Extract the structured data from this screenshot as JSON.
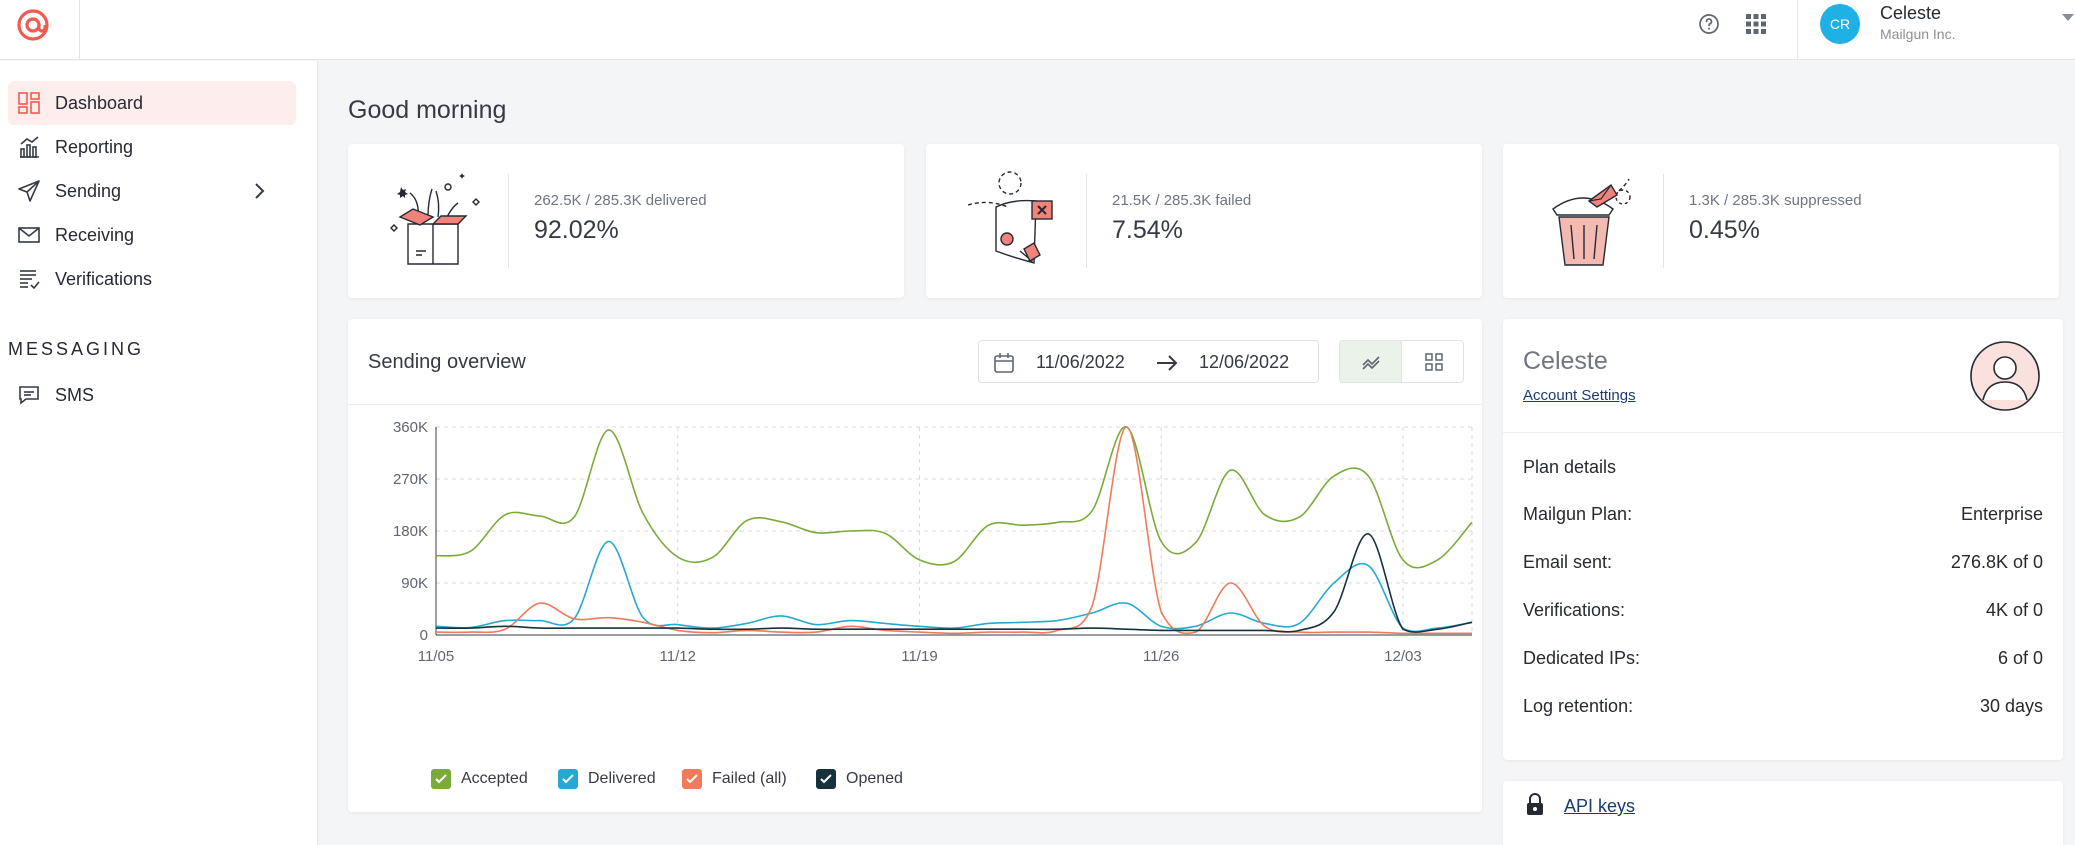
{
  "header": {
    "user_initials": "CR",
    "user_name": "Celeste",
    "user_org": "Mailgun Inc."
  },
  "sidebar": {
    "items": [
      {
        "label": "Dashboard",
        "icon": "dashboard-icon",
        "active": true
      },
      {
        "label": "Reporting",
        "icon": "bar-chart-icon"
      },
      {
        "label": "Sending",
        "icon": "paper-plane-icon",
        "expandable": true
      },
      {
        "label": "Receiving",
        "icon": "envelope-icon"
      },
      {
        "label": "Verifications",
        "icon": "checklist-icon"
      }
    ],
    "section_label": "MESSAGING",
    "messaging_items": [
      {
        "label": "SMS",
        "icon": "chat-icon"
      }
    ]
  },
  "greeting": "Good morning",
  "stats": [
    {
      "subtitle": "262.5K / 285.3K delivered",
      "value": "92.02%",
      "illustration": "open-box-illustration"
    },
    {
      "subtitle": "21.5K / 285.3K failed",
      "value": "7.54%",
      "illustration": "failed-letter-illustration"
    },
    {
      "subtitle": "1.3K / 285.3K suppressed",
      "value": "0.45%",
      "illustration": "trash-can-illustration"
    }
  ],
  "overview": {
    "title": "Sending overview",
    "date_start": "11/06/2022",
    "date_end": "12/06/2022",
    "view_selected": "line"
  },
  "profile": {
    "name": "Celeste",
    "account_settings": "Account Settings",
    "plan_title": "Plan details",
    "rows": [
      {
        "label": "Mailgun Plan:",
        "value": "Enterprise"
      },
      {
        "label": "Email sent:",
        "value": "276.8K of 0"
      },
      {
        "label": "Verifications:",
        "value": "4K of 0"
      },
      {
        "label": "Dedicated IPs:",
        "value": "6 of 0"
      },
      {
        "label": "Log retention:",
        "value": "30 days"
      }
    ]
  },
  "api": {
    "label": "API keys"
  },
  "colors": {
    "accent": "#f05a50",
    "accepted": "#7aab3a",
    "delivered": "#27a9cf",
    "failed": "#ef7b5c",
    "opened": "#16323d"
  },
  "chart_data": {
    "type": "line",
    "x_ticks": [
      "11/05",
      "11/12",
      "11/19",
      "11/26",
      "12/03"
    ],
    "x": [
      "11/05",
      "11/06",
      "11/07",
      "11/08",
      "11/09",
      "11/10",
      "11/11",
      "11/12",
      "11/13",
      "11/14",
      "11/15",
      "11/16",
      "11/17",
      "11/18",
      "11/19",
      "11/20",
      "11/21",
      "11/22",
      "11/23",
      "11/24",
      "11/25",
      "11/26",
      "11/27",
      "11/28",
      "11/29",
      "11/30",
      "12/01",
      "12/02",
      "12/03",
      "12/04",
      "12/05"
    ],
    "ylim": [
      0,
      360000
    ],
    "y_ticks": [
      "0",
      "90K",
      "180K",
      "270K",
      "360K"
    ],
    "grid": true,
    "series": [
      {
        "name": "Accepted",
        "values": [
          137000,
          145000,
          208000,
          206000,
          204000,
          355000,
          210000,
          135000,
          134000,
          198000,
          196000,
          177000,
          180000,
          176000,
          130000,
          127000,
          190000,
          190000,
          195000,
          215000,
          360000,
          162000,
          160000,
          285000,
          208000,
          204000,
          275000,
          275000,
          130000,
          130000,
          195000
        ]
      },
      {
        "name": "Delivered",
        "values": [
          15000,
          13000,
          25000,
          25000,
          28000,
          162000,
          30000,
          18000,
          12000,
          20000,
          33000,
          18000,
          25000,
          20000,
          15000,
          12000,
          20000,
          22000,
          25000,
          38000,
          55000,
          15000,
          15000,
          38000,
          20000,
          20000,
          90000,
          120000,
          12000,
          12000,
          22000
        ]
      },
      {
        "name": "Failed (all)",
        "values": [
          5000,
          5000,
          10000,
          55000,
          28000,
          30000,
          22000,
          8000,
          4000,
          8000,
          5000,
          5000,
          15000,
          8000,
          5000,
          3000,
          5000,
          5000,
          8000,
          50000,
          360000,
          40000,
          5000,
          90000,
          15000,
          5000,
          5000,
          5000,
          3000,
          3000,
          3000
        ]
      },
      {
        "name": "Opened",
        "values": [
          12000,
          12000,
          15000,
          12000,
          12000,
          12000,
          12000,
          12000,
          10000,
          10000,
          12000,
          10000,
          10000,
          10000,
          10000,
          10000,
          10000,
          10000,
          10000,
          12000,
          10000,
          8000,
          8000,
          8000,
          8000,
          8000,
          40000,
          175000,
          10000,
          10000,
          22000
        ]
      }
    ]
  }
}
